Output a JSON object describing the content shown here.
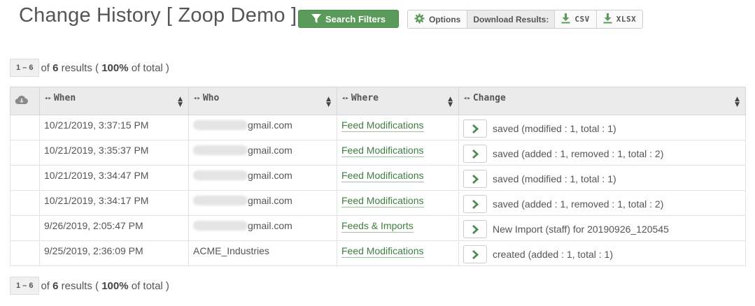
{
  "header": {
    "title": "Change History [ Zoop Demo ]",
    "filters_label": "Search Filters",
    "options_label": "Options",
    "download_label": "Download Results:",
    "csv_label": "CSV",
    "xlsx_label": "XLSX"
  },
  "pager": {
    "range": "1 – 6",
    "of": "of",
    "count": "6",
    "results": "results (",
    "percent": "100%",
    "of_total": "of total )"
  },
  "table": {
    "columns": [
      "When",
      "Who",
      "Where",
      "Change"
    ],
    "rows": [
      {
        "when": "10/21/2019, 3:37:15 PM",
        "who": "gmail.com",
        "who_redacted": true,
        "where": "Feed Modifications",
        "change": "saved (modified : 1, total : 1)"
      },
      {
        "when": "10/21/2019, 3:35:37 PM",
        "who": "gmail.com",
        "who_redacted": true,
        "where": "Feed Modifications",
        "change": "saved (added : 1, removed : 1, total : 2)"
      },
      {
        "when": "10/21/2019, 3:34:47 PM",
        "who": "gmail.com",
        "who_redacted": true,
        "where": "Feed Modifications",
        "change": "saved (modified : 1, total : 1)"
      },
      {
        "when": "10/21/2019, 3:34:17 PM",
        "who": "gmail.com",
        "who_redacted": true,
        "where": "Feed Modifications",
        "change": "saved (added : 1, removed : 1, total : 2)"
      },
      {
        "when": "9/26/2019, 2:05:47 PM",
        "who": "gmail.com",
        "who_redacted": true,
        "where": "Feeds & Imports",
        "change": "New Import (staff) for 20190926_120545"
      },
      {
        "when": "9/25/2019, 2:36:09 PM",
        "who": "ACME_Industries",
        "who_redacted": false,
        "where": "Feed Modifications",
        "change": "created (added : 1, total : 1)"
      }
    ]
  },
  "colors": {
    "accent_green": "#5a9a5a",
    "link_green": "#3f7e3f",
    "header_bg": "#ebebeb"
  },
  "icons": {
    "filter": "filter-icon",
    "options": "gear-icon",
    "download": "download-icon",
    "cloud": "cloud-download-icon",
    "row_action": "chevron-right-icon",
    "sort": "sort-icon"
  }
}
